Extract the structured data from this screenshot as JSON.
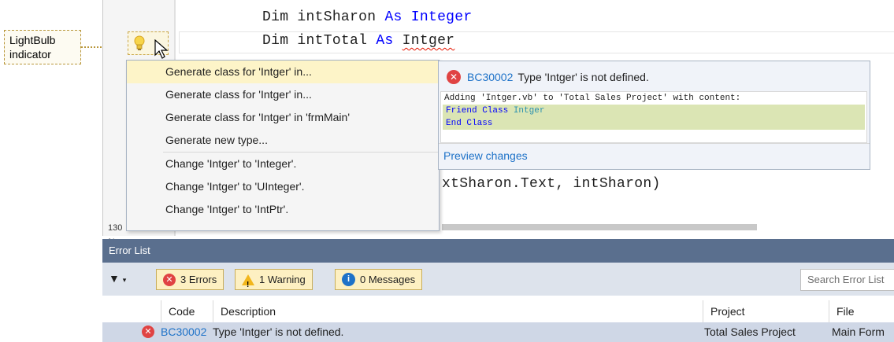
{
  "callout": {
    "text": "LightBulb indicator"
  },
  "editor": {
    "line1": {
      "pre": "Dim intSharon ",
      "kw1": "As",
      "mid": " ",
      "type": "Integer"
    },
    "line2": {
      "pre": "Dim intTotal ",
      "kw1": "As",
      "mid": " ",
      "type": "Intger"
    },
    "line3": "xtSharon.Text, intSharon)",
    "zoom": "130 %"
  },
  "menu": {
    "items": [
      {
        "label": "Generate class for 'Intger' in..."
      },
      {
        "label": "Generate class for 'Intger' in..."
      },
      {
        "label": "Generate class for 'Intger' in 'frmMain'"
      },
      {
        "label": "Generate new type..."
      },
      {
        "label": "Change 'Intger' to 'Integer'."
      },
      {
        "label": "Change 'Intger' to 'UInteger'."
      },
      {
        "label": "Change 'Intger' to 'IntPtr'."
      }
    ]
  },
  "preview": {
    "error_code": "BC30002",
    "error_text": "Type 'Intger' is not defined.",
    "code_line1": "Adding 'Intger.vb' to 'Total Sales Project' with content:",
    "code_line2_kw": "Friend Class ",
    "code_line2_type": "Intger",
    "code_line3": "End Class",
    "link": "Preview changes"
  },
  "error_list": {
    "title": "Error List",
    "errors_btn": "3 Errors",
    "warnings_btn": "1 Warning",
    "messages_btn": "0 Messages",
    "search_placeholder": "Search Error List",
    "columns": {
      "code": "Code",
      "description": "Description",
      "project": "Project",
      "file": "File"
    },
    "row": {
      "code": "BC30002",
      "description": "Type 'Intger' is not defined.",
      "project": "Total Sales Project",
      "file": "Main Form"
    }
  },
  "colors": {
    "error_red": "#e04343",
    "link_blue": "#1e72c8",
    "title_bar": "#5a6f8e",
    "selected_menu": "#fdf4c8"
  }
}
